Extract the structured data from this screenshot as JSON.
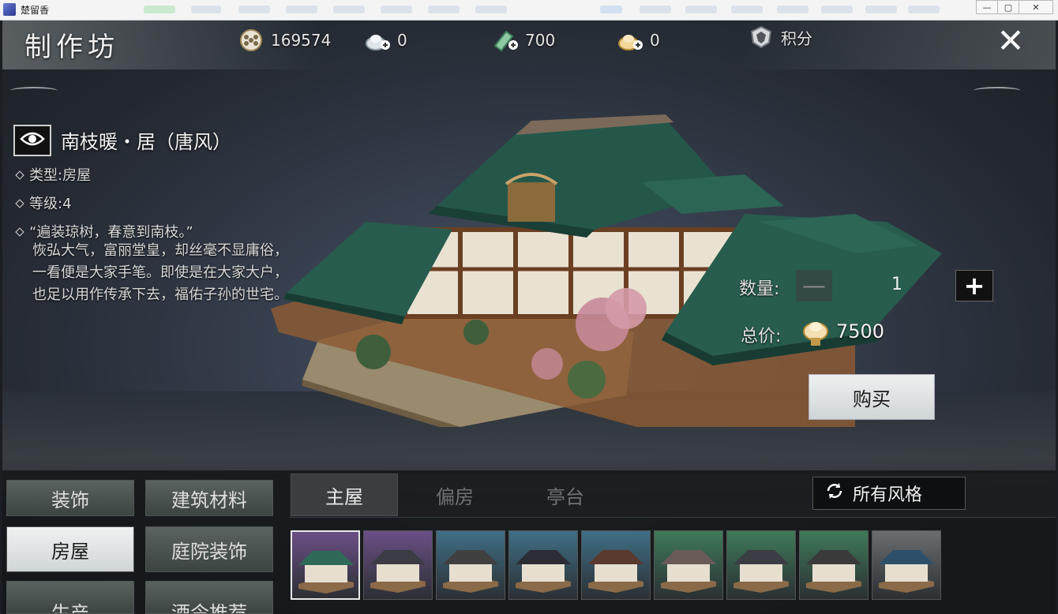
{
  "window": {
    "title": "楚留香",
    "buttons": [
      "—",
      "▢",
      "✕"
    ]
  },
  "header": {
    "title": "制作坊",
    "currencies": [
      {
        "icon": "film-reel-coin-icon",
        "value": "169574"
      },
      {
        "icon": "silver-ingot-plus-icon",
        "value": "0"
      },
      {
        "icon": "jade-plus-icon",
        "value": "700"
      },
      {
        "icon": "gold-ingot-plus-icon",
        "value": "0"
      },
      {
        "icon": "points-shield-icon",
        "value": "积分"
      }
    ],
    "close": "✕"
  },
  "item": {
    "name": "南枝暖・居（唐风）",
    "type": "类型:房屋",
    "level": "等级:4",
    "quote": "“遍装琼树，春意到南枝。”",
    "description": "恢弘大气，富丽堂皇，却丝毫不显庸俗，一看便是大家手笔。即使是在大家大户，也足以用作传承下去，福佑子孙的世宅。"
  },
  "purchase": {
    "qty_label": "数量:",
    "qty_minus": "—",
    "qty_value": "1",
    "qty_plus": "+",
    "price_label": "总价:",
    "price_value": "7500",
    "buy_label": "购买"
  },
  "categories": [
    {
      "label": "装饰",
      "active": false
    },
    {
      "label": "建筑材料",
      "active": false
    },
    {
      "label": "房屋",
      "active": true
    },
    {
      "label": "庭院装饰",
      "active": false
    },
    {
      "label": "生产",
      "active": false
    },
    {
      "label": "酒令推荐",
      "active": false
    }
  ],
  "tabs": [
    {
      "label": "主屋",
      "active": true
    },
    {
      "label": "偏房",
      "active": false
    },
    {
      "label": "亭台",
      "active": false
    }
  ],
  "style_filter": "所有风格",
  "thumbnails": [
    {
      "bg": "#6b4f86",
      "roof": "#2f6a58",
      "selected": true
    },
    {
      "bg": "#6b4f86",
      "roof": "#3c3c44",
      "selected": false
    },
    {
      "bg": "#3f6f86",
      "roof": "#404040",
      "selected": false
    },
    {
      "bg": "#3f6f86",
      "roof": "#2c2c34",
      "selected": false
    },
    {
      "bg": "#3f6f86",
      "roof": "#5a3a2e",
      "selected": false
    },
    {
      "bg": "#3f7a5a",
      "roof": "#6a5a58",
      "selected": false
    },
    {
      "bg": "#3f7a5a",
      "roof": "#3a3d44",
      "selected": false
    },
    {
      "bg": "#3f7a5a",
      "roof": "#3a3a3a",
      "selected": false
    },
    {
      "bg": "#6a6e70",
      "roof": "#2d4f6a",
      "selected": false
    }
  ]
}
